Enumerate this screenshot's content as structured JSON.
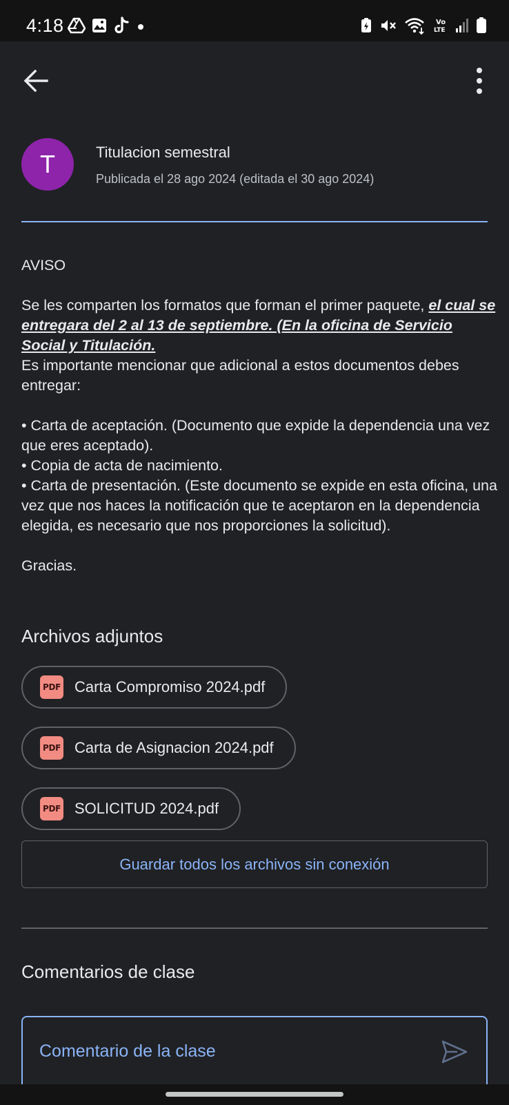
{
  "status_bar": {
    "time": "4:18",
    "left_icons": [
      "drive-icon",
      "gallery-icon",
      "tiktok-icon",
      "dot-icon"
    ],
    "right_icons": [
      "battery-saver-icon",
      "mute-icon",
      "wifi-icon",
      "volte-icon",
      "signal-icon",
      "battery-icon"
    ],
    "volte_label_top": "Vo",
    "volte_label_bottom": "LTE"
  },
  "app_bar": {
    "back_icon": "arrow-back-icon",
    "more_icon": "more-vert-icon"
  },
  "post": {
    "avatar_letter": "T",
    "avatar_color": "#8e24aa",
    "title": "Titulacion semestral",
    "meta": "Publicada el 28 ago 2024 (editada el 30 ago 2024)"
  },
  "body": {
    "heading": "AVISO",
    "intro": "Se les comparten los formatos que forman el primer paquete, ",
    "emphasis": "el cual se entregara del 2 al 13 de septiembre. (En la oficina de Servicio Social y Titulación.",
    "line2": "Es importante mencionar que adicional a estos documentos debes entregar:",
    "bullets": [
      "• Carta de aceptación. (Documento que expide la dependencia una vez que eres aceptado).",
      "• Copia de acta de nacimiento.",
      "• Carta de presentación. (Este documento se expide en esta oficina, una vez que nos haces la notificación que te aceptaron en la dependencia elegida, es necesario que nos proporciones la solicitud)."
    ],
    "closing": "Gracias."
  },
  "attachments": {
    "heading": "Archivos adjuntos",
    "badge": "PDF",
    "files": [
      {
        "name": "Carta Compromiso 2024.pdf"
      },
      {
        "name": "Carta de Asignacion 2024.pdf"
      },
      {
        "name": "SOLICITUD 2024.pdf"
      }
    ],
    "save_all_label": "Guardar todos los archivos sin conexión"
  },
  "comments": {
    "heading": "Comentarios de clase",
    "placeholder": "Comentario de la clase",
    "send_icon": "send-icon"
  },
  "colors": {
    "background": "#202124",
    "accent": "#8ab4f8",
    "pdf_badge": "#f28b82"
  }
}
